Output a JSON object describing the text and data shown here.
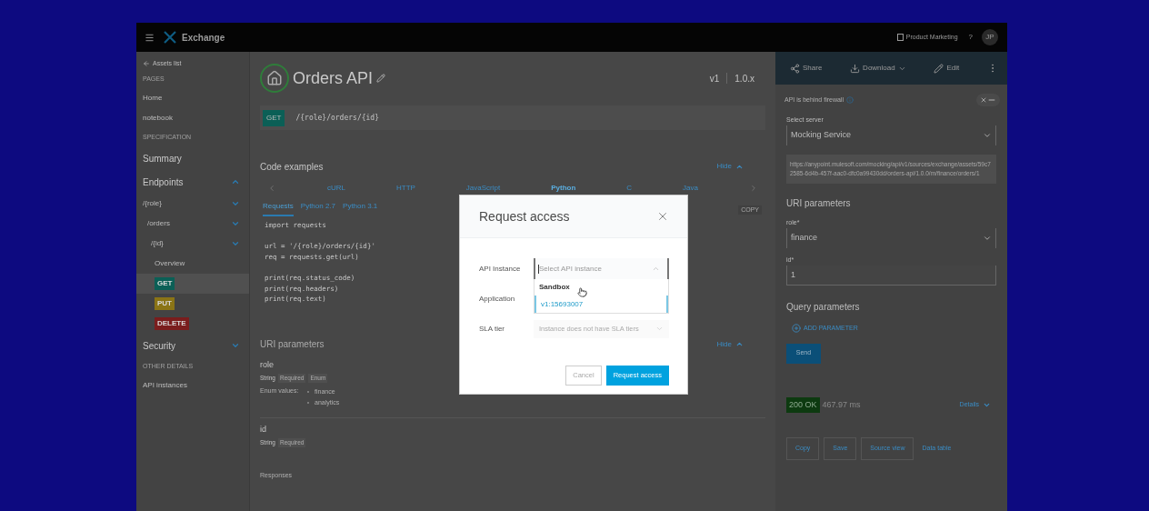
{
  "top_bar": {
    "app_name": "Exchange",
    "account": "Product Marketing",
    "help": "?",
    "avatar": "JP"
  },
  "sidebar": {
    "back_link": "Assets list",
    "groups": [
      {
        "heading": "PAGES",
        "items": [
          {
            "label": "Home",
            "kind": "page"
          },
          {
            "label": "notebook",
            "kind": "page"
          }
        ]
      },
      {
        "heading": "SPECIFICATION",
        "items": [
          {
            "label": "Summary",
            "kind": "top"
          },
          {
            "label": "Endpoints",
            "kind": "top",
            "expanded": true,
            "children": [
              {
                "label": "/{role}",
                "expanded": false,
                "children": [
                  {
                    "label": "/orders",
                    "expanded": false,
                    "children": [
                      {
                        "label": "/{id}",
                        "expanded": false,
                        "children": [
                          {
                            "label": "Overview",
                            "kind": "link",
                            "selected": false
                          },
                          {
                            "label": "GET",
                            "kind": "method",
                            "color": "#0b5f56",
                            "selected": true
                          },
                          {
                            "label": "PUT",
                            "kind": "method",
                            "color": "#8a7416",
                            "selected": false
                          },
                          {
                            "label": "DELETE",
                            "kind": "method",
                            "color": "#7a1d1d",
                            "selected": false
                          }
                        ]
                      }
                    ]
                  }
                ]
              }
            ]
          },
          {
            "label": "Security",
            "kind": "top",
            "expanded": false
          }
        ]
      },
      {
        "heading": "OTHER DETAILS",
        "items": [
          {
            "label": "API instances",
            "kind": "page"
          }
        ]
      }
    ]
  },
  "main": {
    "title": "Orders API",
    "version": "v1",
    "version_range": "1.0.x",
    "endpoint": {
      "method": "GET",
      "path": "/{role}/orders/{id}"
    },
    "code_examples": {
      "title": "Code examples",
      "hide": "Hide",
      "languages": [
        {
          "label": "cURL",
          "selected": false
        },
        {
          "label": "HTTP",
          "selected": false
        },
        {
          "label": "JavaScript",
          "selected": false
        },
        {
          "label": "Python",
          "selected": true
        },
        {
          "label": "C",
          "selected": false
        },
        {
          "label": "Java",
          "selected": false
        }
      ],
      "variants": [
        {
          "label": "Requests",
          "selected": true
        },
        {
          "label": "Python 2.7",
          "selected": false
        },
        {
          "label": "Python 3.1",
          "selected": false
        }
      ],
      "copy": "COPY",
      "code": [
        [
          "import requests"
        ],
        [
          "url = '/{role}/orders/{id}'",
          "req = requests.get(url)"
        ],
        [
          "print(req.status_code)",
          "print(req.headers)",
          "print(req.text)"
        ]
      ]
    },
    "uri_parameters": {
      "title": "URI parameters",
      "hide": "Hide",
      "params": [
        {
          "name": "role",
          "type": "String",
          "tags": [
            "Required",
            "Enum"
          ],
          "enum_label": "Enum values:",
          "enum_values": [
            "finance",
            "analytics"
          ]
        },
        {
          "name": "id",
          "type": "String",
          "tags": [
            "Required"
          ]
        }
      ]
    },
    "responses_title": "Responses"
  },
  "console": {
    "actions": [
      {
        "label": "Share",
        "kind": "share"
      },
      {
        "label": "Download",
        "kind": "download"
      },
      {
        "label": "Edit",
        "kind": "edit"
      }
    ],
    "firewall_notice": "API is behind firewall",
    "server": {
      "label": "Select server",
      "value": "Mocking Service"
    },
    "url": "https://anypoint.mulesoft.com/mocking/api/v1/sources/exchange/assets/59c72585-6d4b-457f-aac0-dfc0a99430dd/orders-api/1.0.0/m/finance/orders/1",
    "uri_title": "URI parameters",
    "fields": [
      {
        "label": "role*",
        "value": "finance",
        "kind": "select"
      },
      {
        "label": "id*",
        "value": "1",
        "kind": "input"
      }
    ],
    "query_title": "Query parameters",
    "add_parameter": "ADD PARAMETER",
    "send": "Send",
    "response": {
      "status": "200 OK",
      "time": "467.97 ms",
      "details": "Details"
    },
    "buttons": [
      {
        "label": "Copy",
        "kind": "button"
      },
      {
        "label": "Save",
        "kind": "button"
      },
      {
        "label": "Source view",
        "kind": "button"
      },
      {
        "label": "Data table",
        "kind": "link"
      }
    ]
  },
  "dialog": {
    "title": "Request access",
    "fields": [
      {
        "label": "API Instance",
        "placeholder": "Select API instance",
        "kind": "open-select",
        "options": [
          {
            "label": "Sandbox",
            "kind": "group"
          },
          {
            "label": "v1:15693007",
            "kind": "option"
          }
        ]
      },
      {
        "label": "Application",
        "kind": "covered"
      },
      {
        "label": "SLA tier",
        "placeholder": "Instance does not have SLA tiers",
        "kind": "select",
        "disabled": true
      }
    ],
    "cancel": "Cancel",
    "submit": "Request access"
  }
}
